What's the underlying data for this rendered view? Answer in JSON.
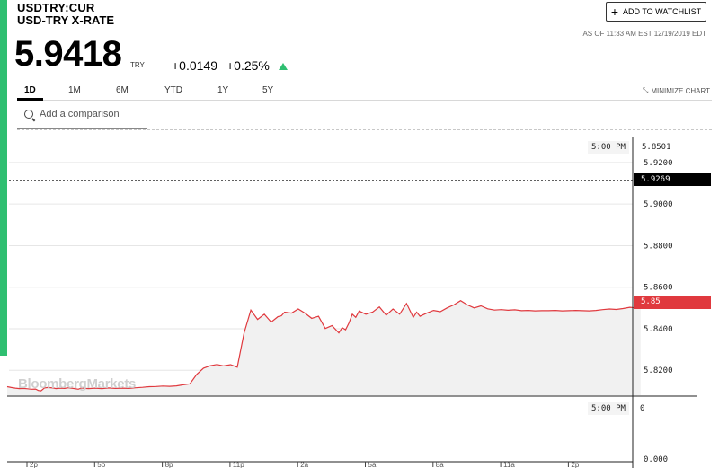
{
  "quote": {
    "ticker": "USDTRY:CUR",
    "name": "USD-TRY X-RATE",
    "price": "5.9418",
    "currency": "TRY",
    "change": "+0.0149",
    "change_pct": "+0.25%",
    "direction": "up",
    "as_of": "AS OF 11:33 AM EST 12/19/2019 EDT"
  },
  "watchlist_label": "ADD TO WATCHLIST",
  "tabs": [
    {
      "label": "1D",
      "active": true
    },
    {
      "label": "1M",
      "active": false
    },
    {
      "label": "6M",
      "active": false
    },
    {
      "label": "YTD",
      "active": false
    },
    {
      "label": "1Y",
      "active": false
    },
    {
      "label": "5Y",
      "active": false
    }
  ],
  "minimize_label": "MINIMIZE CHART",
  "comparison_placeholder": "Add a comparison",
  "watermark": "BloombergMarkets",
  "colors": {
    "accent_green": "#2fbf71",
    "line_red": "#e0393e",
    "current_box": "#000000"
  },
  "chart_data": {
    "type": "line",
    "y_axis_ticks": [
      "5.9200",
      "5.9000",
      "5.8800",
      "5.8600",
      "5.8400",
      "5.8200"
    ],
    "ylim": [
      5.808,
      5.9325
    ],
    "top_label": {
      "time": "5:00 PM",
      "value": "5.8501"
    },
    "prev_close": "5.9269",
    "last_value": "5.85",
    "x_tick_labels": [
      "2p",
      "5p",
      "8p",
      "11p",
      "2a",
      "5a",
      "8a",
      "11a",
      "2p"
    ],
    "series": [
      {
        "x": [
          0,
          0.06,
          0.12,
          0.18,
          0.24,
          0.3,
          0.36,
          0.42,
          0.46,
          0.5,
          0.55,
          0.6,
          0.68,
          0.72,
          0.78,
          0.85,
          0.9,
          1.0,
          1.05,
          1.1,
          1.15,
          1.2,
          1.3,
          1.4,
          1.5,
          1.6,
          1.7,
          1.8,
          1.9,
          2.0,
          2.1,
          2.2,
          2.3,
          2.4,
          2.5,
          2.6,
          2.7,
          2.8,
          2.9,
          3.0,
          3.1,
          3.2,
          3.3,
          3.4,
          3.5,
          3.6,
          3.7,
          3.8,
          3.9,
          4.0,
          4.05,
          4.1,
          4.2,
          4.3,
          4.4,
          4.5,
          4.6,
          4.7,
          4.8,
          4.9,
          4.95,
          5.0,
          5.05,
          5.1,
          5.15,
          5.2,
          5.3,
          5.4,
          5.5,
          5.6,
          5.7,
          5.8,
          5.9,
          6.0,
          6.05,
          6.1,
          6.2,
          6.3,
          6.4,
          6.5,
          6.6,
          6.7,
          6.8,
          6.9,
          7.0,
          7.1,
          7.2,
          7.3,
          7.4,
          7.5,
          7.6,
          7.7,
          7.8,
          7.9,
          8.0,
          8.1,
          8.2,
          8.3,
          8.4,
          8.5,
          8.6,
          8.7,
          8.8,
          8.9,
          9.0,
          9.1,
          9.2,
          9.3,
          9.36
        ],
        "y": [
          5.8121,
          5.8117,
          5.8114,
          5.8112,
          5.8113,
          5.8111,
          5.8109,
          5.811,
          5.8103,
          5.8101,
          5.8115,
          5.8117,
          5.8115,
          5.8112,
          5.8114,
          5.8113,
          5.8116,
          5.8112,
          5.8109,
          5.8115,
          5.8113,
          5.8112,
          5.8114,
          5.8112,
          5.8115,
          5.8113,
          5.8114,
          5.8113,
          5.8116,
          5.8118,
          5.8121,
          5.8122,
          5.8124,
          5.8123,
          5.8125,
          5.813,
          5.8135,
          5.818,
          5.821,
          5.8222,
          5.8228,
          5.8221,
          5.8227,
          5.8215,
          5.838,
          5.849,
          5.8445,
          5.847,
          5.8432,
          5.8458,
          5.8462,
          5.848,
          5.8475,
          5.8495,
          5.8475,
          5.845,
          5.846,
          5.8401,
          5.8415,
          5.838,
          5.8405,
          5.8395,
          5.8428,
          5.847,
          5.8455,
          5.8485,
          5.847,
          5.848,
          5.8505,
          5.8465,
          5.8495,
          5.847,
          5.8522,
          5.8455,
          5.848,
          5.846,
          5.8475,
          5.8488,
          5.8482,
          5.85,
          5.8515,
          5.8535,
          5.8515,
          5.85,
          5.851,
          5.8496,
          5.849,
          5.8492,
          5.8489,
          5.8491,
          5.8487,
          5.8488,
          5.8486,
          5.8487,
          5.8487,
          5.8488,
          5.8486,
          5.8487,
          5.8488,
          5.8487,
          5.8486,
          5.8488,
          5.8492,
          5.8495,
          5.8493,
          5.8497,
          5.8503,
          5.85,
          5.8501
        ]
      }
    ],
    "volume_panel": {
      "time": "5:00 PM",
      "value": "0",
      "axis_min": "0.000"
    }
  }
}
